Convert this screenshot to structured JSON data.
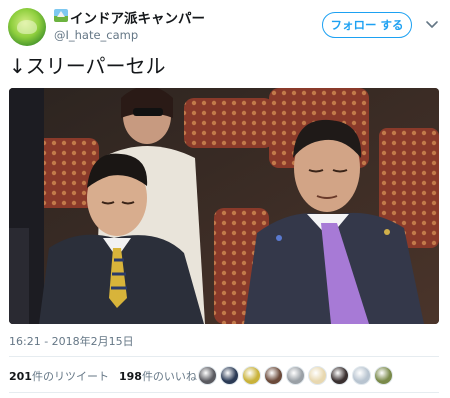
{
  "author": {
    "display_name": "インドア派キャンパー",
    "handle": "@I_hate_camp",
    "avatar_icon": "green-frog-avatar-icon",
    "badge_icon": "camp-picture-icon"
  },
  "header": {
    "follow_label": "フォロー する",
    "menu_icon": "chevron-down-icon"
  },
  "tweet": {
    "text": "↓スリーパーセル",
    "image_alt": "photo-two-men-dozing-in-parliament",
    "timestamp": "16:21 - 2018年2月15日"
  },
  "stats": {
    "retweets_count": "201",
    "retweets_label": "件のリツイート",
    "likes_count": "198",
    "likes_label": "件のいいね"
  },
  "likers": [
    {
      "name": "liker-avatar-1",
      "color": "#5a5a60"
    },
    {
      "name": "liker-avatar-2",
      "color": "#2b3a55"
    },
    {
      "name": "liker-avatar-3",
      "color": "#c9b23a"
    },
    {
      "name": "liker-avatar-4",
      "color": "#6b4a3a"
    },
    {
      "name": "liker-avatar-5",
      "color": "#9aa0a6"
    },
    {
      "name": "liker-avatar-6",
      "color": "#e8d8b0"
    },
    {
      "name": "liker-avatar-7",
      "color": "#3a3030"
    },
    {
      "name": "liker-avatar-8",
      "color": "#b8c4d0"
    },
    {
      "name": "liker-avatar-9",
      "color": "#7a8a4a"
    }
  ],
  "colors": {
    "accent": "#1da1f2",
    "muted": "#657786",
    "text": "#14171a",
    "divider": "#e6ecf0"
  }
}
